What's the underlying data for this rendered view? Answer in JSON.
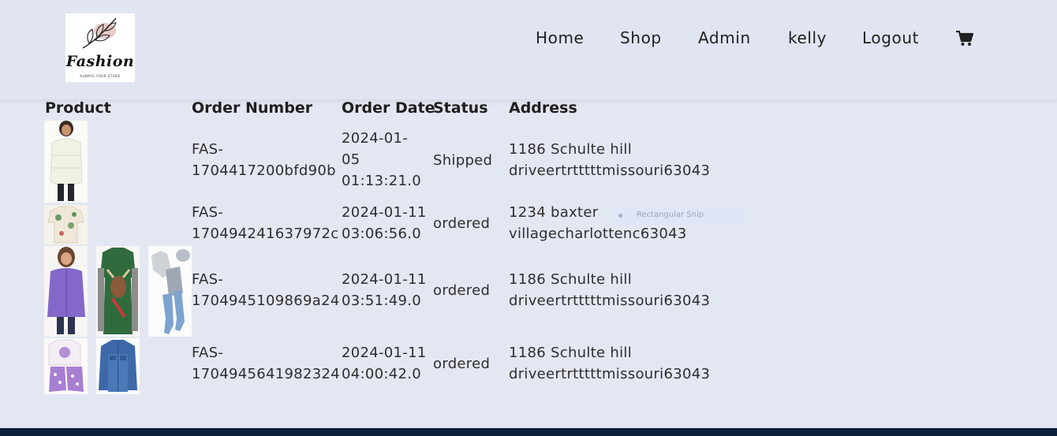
{
  "header": {
    "logo": {
      "brand": "Fashion",
      "tagline": "ALWAYS YOUR STORE"
    },
    "nav": [
      {
        "label": "Home"
      },
      {
        "label": "Shop"
      },
      {
        "label": "Admin"
      },
      {
        "label": "kelly"
      },
      {
        "label": "Logout"
      }
    ],
    "cart_icon": "shopping-cart-icon"
  },
  "orders": {
    "columns": [
      "Product",
      "Order Number",
      "Order Date",
      "Status",
      "Address"
    ],
    "rows": [
      {
        "order_number": [
          "FAS-",
          "1704417200bfd90b"
        ],
        "order_date": [
          "2024-01-",
          "05",
          "01:13:21.0"
        ],
        "status": "Shipped",
        "address": [
          "1186 Schulte hill",
          "driveertrtttttmissouri63043"
        ],
        "products": [
          "white puffer jacket"
        ]
      },
      {
        "order_number": [
          "FAS-",
          "170494241637972c"
        ],
        "order_date": [
          "2024-01-11",
          "03:06:56.0"
        ],
        "status": "ordered",
        "address": [
          "1234 baxter",
          "villagecharlottenc63043"
        ],
        "products": [
          "floral print shirt"
        ]
      },
      {
        "order_number": [
          "FAS-",
          "1704945109869a24"
        ],
        "order_date": [
          "2024-01-11",
          "03:51:49.0"
        ],
        "status": "ordered",
        "address": [
          "1186 Schulte hill",
          "driveertrtttttmissouri63043"
        ],
        "products": [
          "purple fleece jacket",
          "green moose dress",
          "baby bodysuit set"
        ]
      },
      {
        "order_number": [
          "FAS-",
          "1704945641982324"
        ],
        "order_date": [
          "2024-01-11",
          "04:00:42.0"
        ],
        "status": "ordered",
        "address": [
          "1186 Schulte hill",
          "driveertrtttttmissouri63043"
        ],
        "products": [
          "purple polka dot pajama set",
          "denim jacket"
        ]
      }
    ]
  },
  "overlay": {
    "snip_label": "Rectangular Snip"
  },
  "colors": {
    "page_bg": "#e3e7f2",
    "header_bg": "#e1e5f1",
    "footer_bg": "#0e1f3a"
  }
}
